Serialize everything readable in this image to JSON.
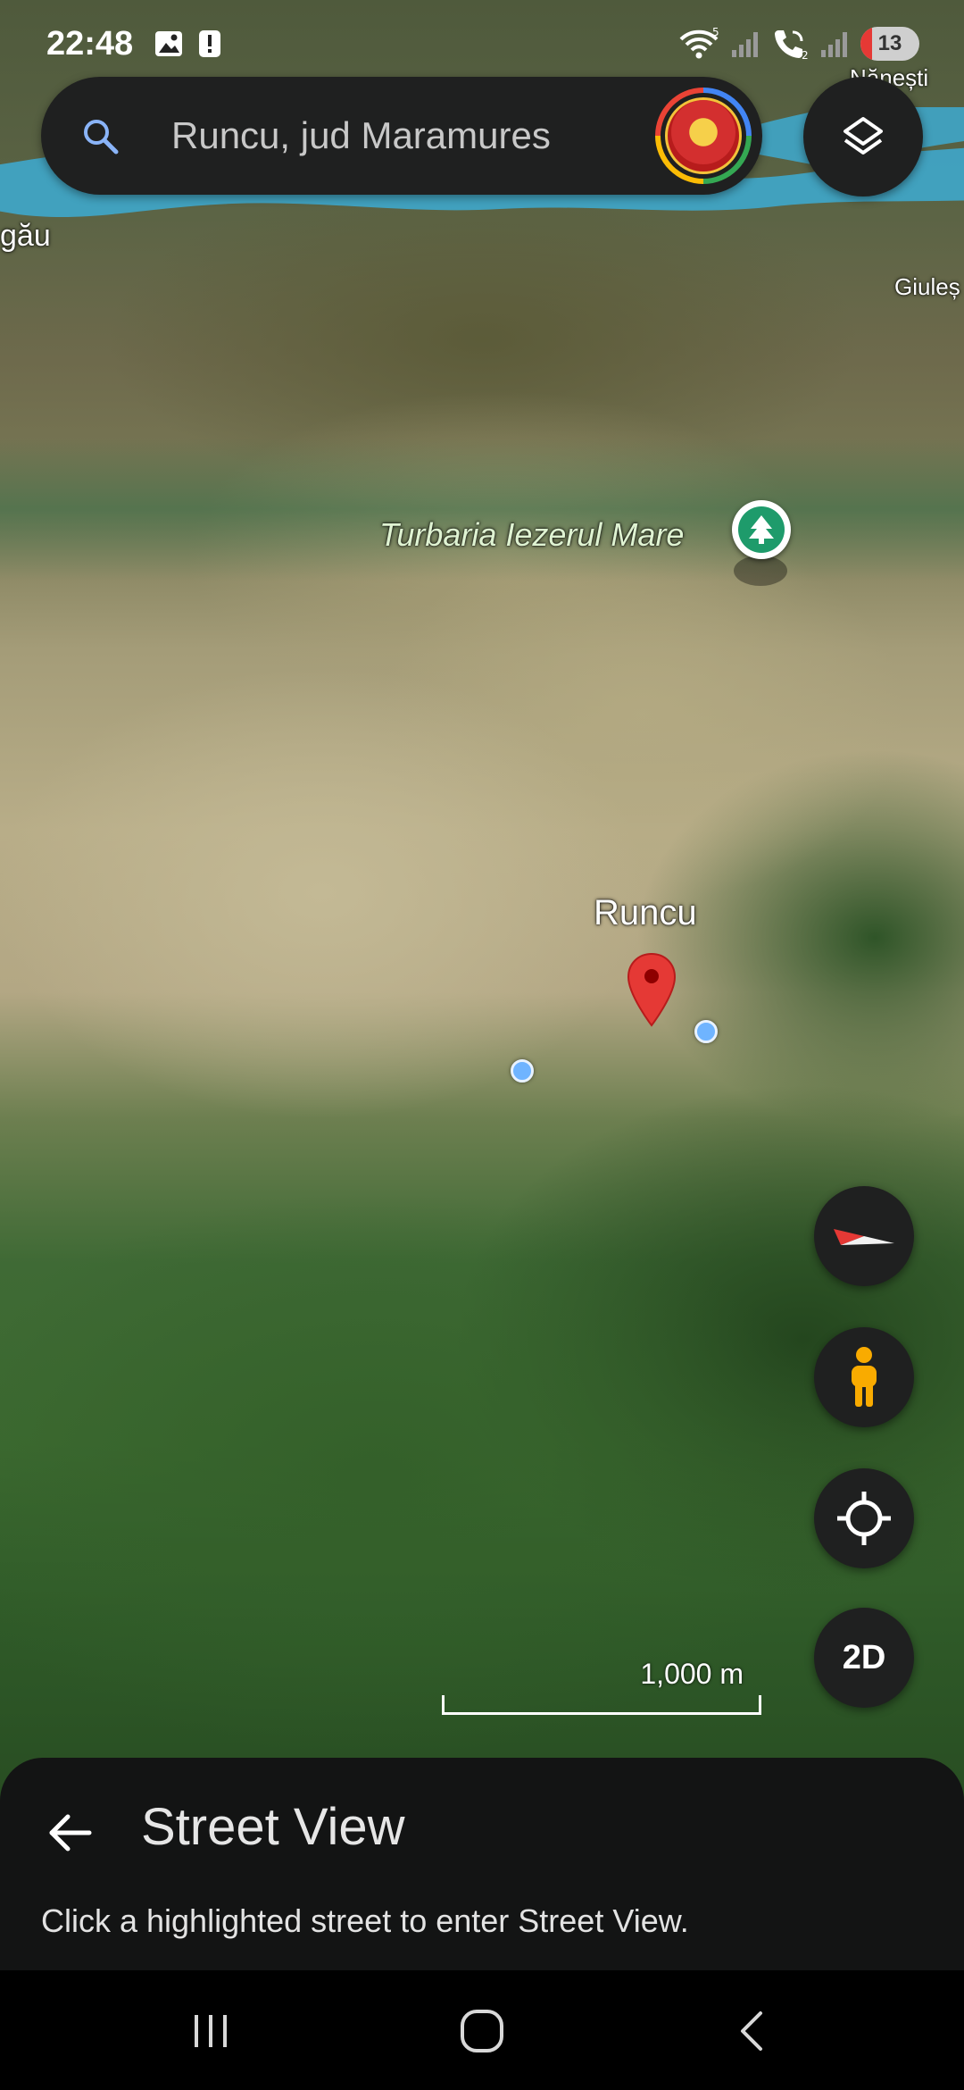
{
  "status_bar": {
    "time": "22:48",
    "battery": "13",
    "wifi_badge": "5",
    "call_badge": "2"
  },
  "search": {
    "value": "Runcu, jud Maramures"
  },
  "map": {
    "labels": {
      "poi": "Turbaria Iezerul Mare",
      "place": "Runcu",
      "top_right_town": "Nănești",
      "left_town": "gău",
      "right_town": "Giuleș"
    },
    "scale": "1,000 m",
    "poi_icon": "tree-icon",
    "colors": {
      "poi": "#1e9b6b",
      "marker": "#e53935",
      "street_view_dot": "#6fb4ff",
      "river": "#3fa6c9"
    }
  },
  "controls": {
    "view_mode": "2D"
  },
  "bottom_sheet": {
    "title": "Street View",
    "hint": "Click a highlighted street to enter Street View."
  }
}
